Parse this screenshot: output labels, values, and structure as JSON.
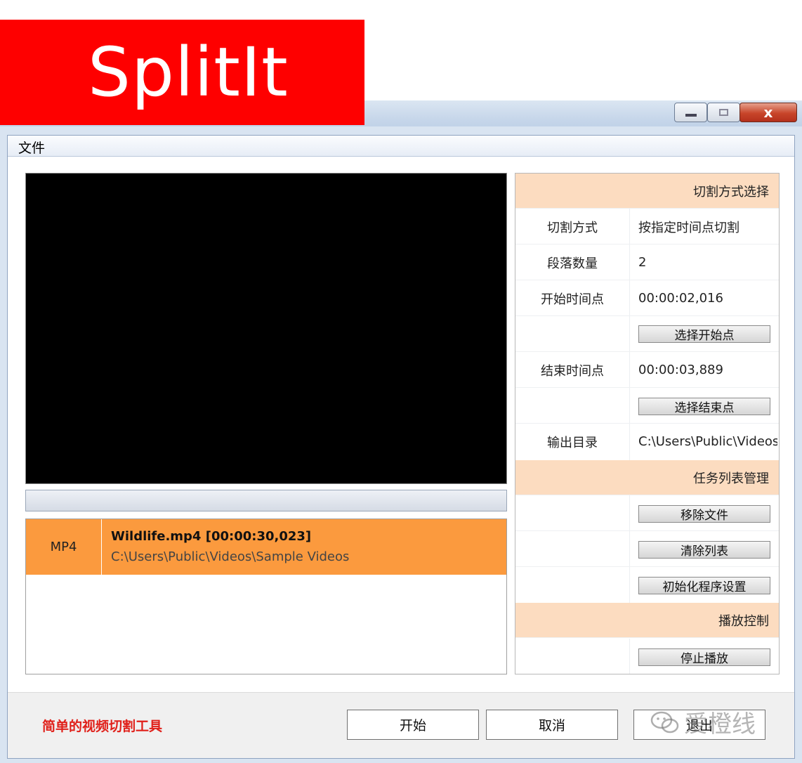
{
  "banner": {
    "text": "SplitIt"
  },
  "window": {
    "close_glyph": "x"
  },
  "menu": {
    "file": "文件"
  },
  "file_list": {
    "items": [
      {
        "ext": "MP4",
        "name": "Wildlife.mp4 [00:00:30,023]",
        "path": "C:\\Users\\Public\\Videos\\Sample Videos"
      }
    ]
  },
  "panel": {
    "section_split": "切割方式选择",
    "split_mode_label": "切割方式",
    "split_mode_value": "按指定时间点切割",
    "segments_label": "段落数量",
    "segments_value": "2",
    "start_label": "开始时间点",
    "start_value": "00:00:02,016",
    "select_start_button": "选择开始点",
    "end_label": "结束时间点",
    "end_value": "00:00:03,889",
    "select_end_button": "选择结束点",
    "output_label": "输出目录",
    "output_value": "C:\\Users\\Public\\Videos",
    "section_tasks": "任务列表管理",
    "remove_file_button": "移除文件",
    "clear_list_button": "清除列表",
    "reset_settings_button": "初始化程序设置",
    "section_playback": "播放控制",
    "stop_playback_button": "停止播放"
  },
  "footer": {
    "tagline": "简单的视频切割工具",
    "start_button": "开始",
    "cancel_button": "取消",
    "exit_button": "退出"
  },
  "watermark": {
    "text": "爱橙线"
  },
  "colors": {
    "banner": "#fe0000",
    "selected_row": "#fb9a3e",
    "section_header": "#fcdcc0",
    "tagline": "#e0201a"
  }
}
